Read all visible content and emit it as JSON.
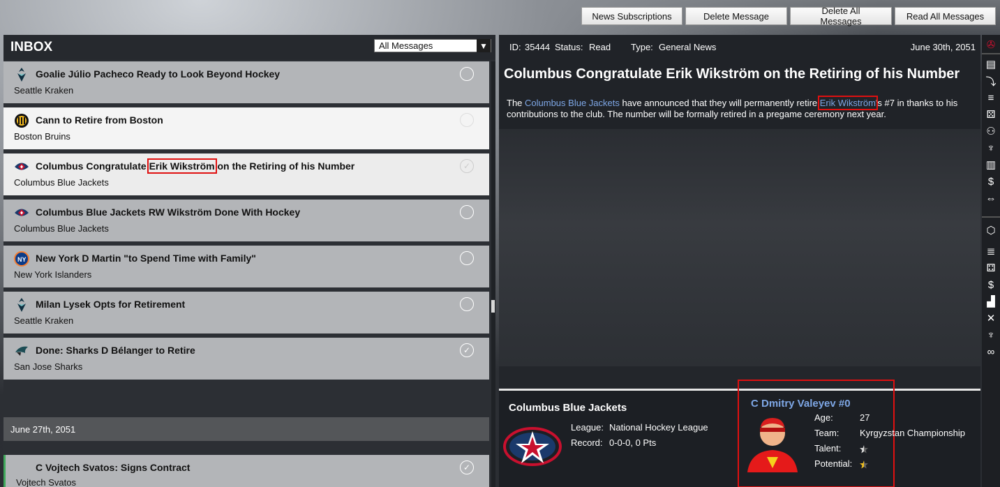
{
  "toolbar": {
    "news_subscriptions": "News Subscriptions",
    "delete_message": "Delete Message",
    "delete_all_messages": "Delete All Messages",
    "read_all_messages": "Read All Messages"
  },
  "inbox": {
    "title": "INBOX",
    "filter_value": "All Messages",
    "messages": [
      {
        "subject": "Goalie Júlio Pacheco Ready to Look Beyond Hockey",
        "team": "Seattle Kraken",
        "icon": "kraken-logo-icon",
        "read": false
      },
      {
        "subject": "Cann to Retire from Boston",
        "team": "Boston Bruins",
        "icon": "bruins-logo-icon",
        "read": false
      },
      {
        "subject_pre": "Columbus Congratulate ",
        "subject_hl": "Erik Wikström",
        "subject_post": " on the Retiring of his Number",
        "team": "Columbus Blue Jackets",
        "icon": "blue-jackets-logo-icon",
        "read": true
      },
      {
        "subject": "Columbus Blue Jackets RW Wikström Done With Hockey",
        "team": "Columbus Blue Jackets",
        "icon": "blue-jackets-logo-icon",
        "read": false
      },
      {
        "subject": "New York D Martin \"to Spend Time with Family\"",
        "team": "New York Islanders",
        "icon": "islanders-logo-icon",
        "read": false
      },
      {
        "subject": "Milan Lysek Opts for Retirement",
        "team": "Seattle Kraken",
        "icon": "kraken-logo-icon",
        "read": false
      },
      {
        "subject": "Done: Sharks D Bélanger to Retire",
        "team": "San Jose Sharks",
        "icon": "sharks-logo-icon",
        "read": true
      }
    ],
    "date_separator": "June 27th, 2051",
    "bottom_message": {
      "subject": "C Vojtech Svatos: Signs Contract",
      "team": "Vojtech Svatos",
      "read": true
    }
  },
  "detail": {
    "id_label": "ID:",
    "id_value": "35444",
    "status_label": "Status:",
    "status_value": "Read",
    "type_label": "Type:",
    "type_value": "General News",
    "date": "June 30th, 2051",
    "title": "Columbus Congratulate Erik Wikström on the Retiring of his Number",
    "body_1": "The ",
    "body_link_team": "Columbus Blue Jackets",
    "body_2": " have announced that they will permanently retire ",
    "body_link_player": "Erik Wikström",
    "body_3": "'s #7 in thanks to his contributions to the club. The number will be formally retired in a pregame ceremony next year.",
    "team_card": {
      "name": "Columbus Blue Jackets",
      "league_label": "League:",
      "league_value": "National Hockey League",
      "record_label": "Record:",
      "record_value": "0-0-0, 0 Pts"
    },
    "player_card": {
      "name": "C Dmitry Valeyev #0",
      "age_label": "Age:",
      "age_value": "27",
      "team_label": "Team:",
      "team_value": "Kyrgyzstan Championship",
      "talent_label": "Talent:",
      "talent_stars": 0.5,
      "potential_label": "Potential:",
      "potential_stars": 0.5
    }
  },
  "colors": {
    "link": "#7ea7e6",
    "highlight_box": "#e01010",
    "star_gold": "#f0c020"
  }
}
